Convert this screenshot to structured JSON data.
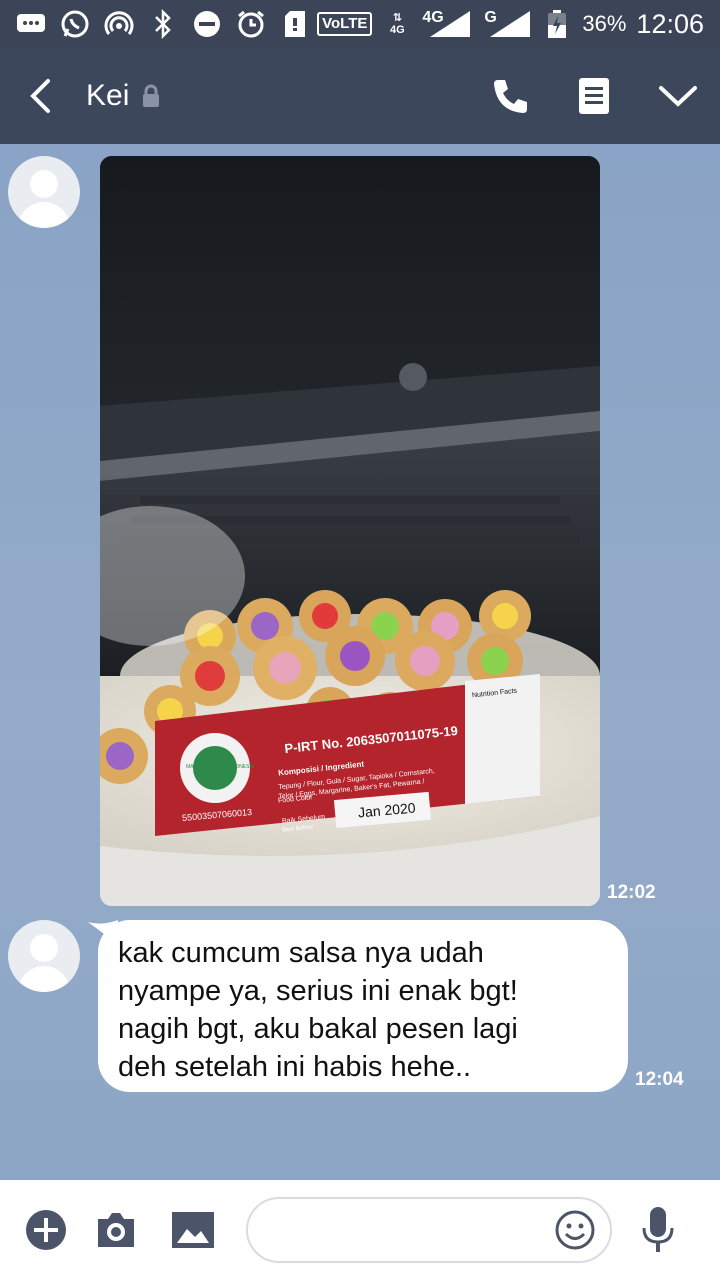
{
  "status_bar": {
    "battery_percent": "36%",
    "time": "12:06",
    "volte_label": "VoLTE",
    "network_4g": "4G",
    "network_g": "G",
    "network_4g_small": "4G"
  },
  "header": {
    "title": "Kei",
    "back_icon": "chevron-left-icon",
    "lock_icon": "lock-icon",
    "call_icon": "phone-icon",
    "notes_icon": "notes-icon",
    "more_icon": "chevron-down-icon"
  },
  "messages": [
    {
      "type": "image",
      "sender": "Kei",
      "time": "12:02",
      "photo_text": {
        "pirt": "P-IRT No. 2063507011075-19",
        "composition": "Komposisi / Ingredient",
        "composition_detail_1": "Tepung / Flour, Gula / Sugar, Tapioka / Cornstarch,",
        "composition_detail_2": "Telor / Eggs, Margarine, Baker's Fat, Pewarna /",
        "composition_detail_3": "Food Color",
        "best_before_label": "Baik Sebelum",
        "best_before_sub": "Best Before",
        "best_before_value": "Jan 2020",
        "barcode": "55003507060013",
        "seal_text": "MAJELIS ULAMA INDONESIA",
        "nutrition_title": "Nutrition Facts"
      }
    },
    {
      "type": "text",
      "sender": "Kei",
      "time": "12:04",
      "lines": [
        "kak cumcum salsa nya udah",
        "nyampe ya, serius ini enak bgt!",
        "nagih bgt, aku bakal pesen lagi",
        "deh setelah ini habis hehe.."
      ]
    }
  ],
  "input_bar": {
    "placeholder": "",
    "add_icon": "plus-circle-icon",
    "camera_icon": "camera-icon",
    "gallery_icon": "image-icon",
    "emoji_icon": "smiley-icon",
    "mic_icon": "microphone-icon"
  },
  "colors": {
    "status_bar_bg": "#3c4558",
    "app_bar_bg": "#3d475c",
    "chat_bg": "#8aa3c4",
    "bubble_bg": "#ffffff",
    "label_red": "#b3242c"
  }
}
